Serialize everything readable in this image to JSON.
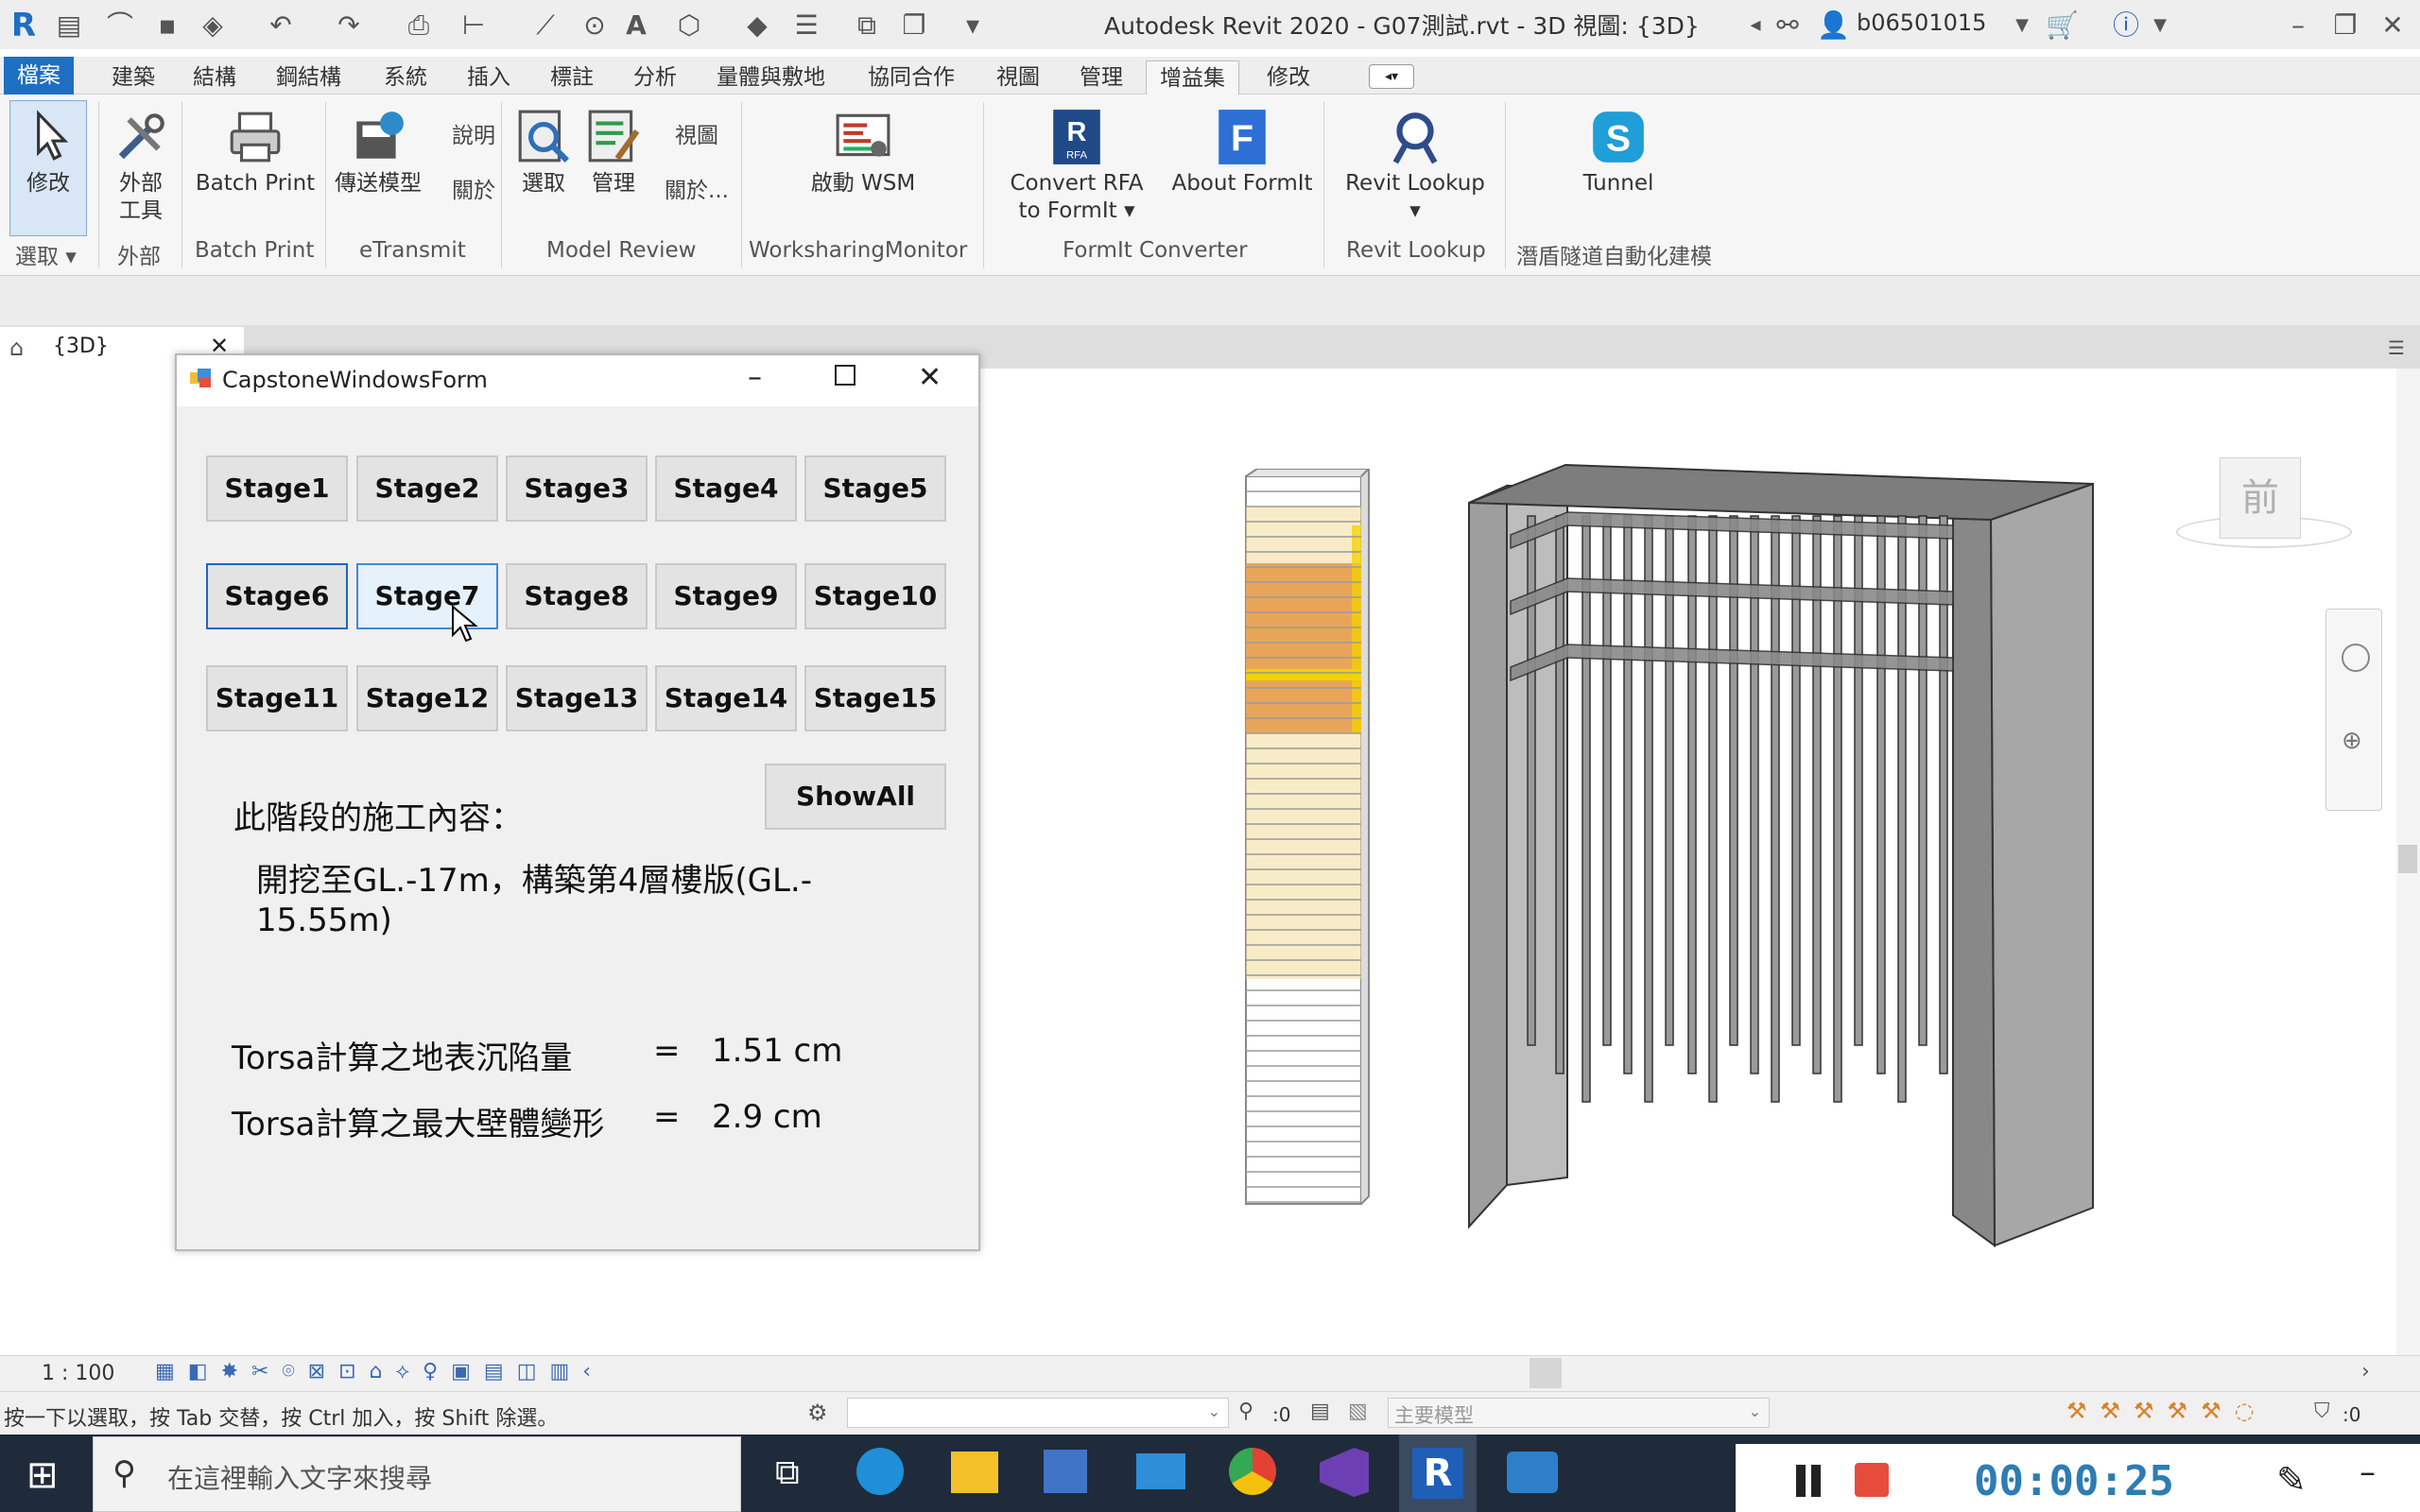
{
  "window": {
    "title": "Autodesk Revit 2020 - G07測試.rvt - 3D 視圖: {3D}",
    "username": "b06501015"
  },
  "menu": {
    "tabs": [
      "檔案",
      "建築",
      "結構",
      "鋼結構",
      "系統",
      "插入",
      "標註",
      "分析",
      "量體與敷地",
      "協同合作",
      "視圖",
      "管理",
      "增益集",
      "修改"
    ],
    "active": "增益集"
  },
  "ribbon": {
    "modify": "修改",
    "external_tools": [
      "外部",
      "工具"
    ],
    "batch_print": "Batch Print",
    "etransmit": "傳送模型",
    "help_label": "說明",
    "about_label": "關於",
    "select_label": "選取",
    "manage_label": "管理",
    "view_label": "視圖",
    "about_dots_label": "關於...",
    "wsm": "啟動 WSM",
    "convert_rfa": [
      "Convert RFA",
      "to FormIt"
    ],
    "about_formit": "About FormIt",
    "revit_lookup": "Revit Lookup",
    "tunnel": "Tunnel",
    "groups": {
      "select": "選取",
      "external": "外部",
      "batch_print": "Batch Print",
      "etransmit": "eTransmit",
      "model_review": "Model Review",
      "worksharing": "WorksharingMonitor",
      "formit": "FormIt Converter",
      "revit_lookup": "Revit Lookup",
      "tunnel_auto": "潛盾隧道自動化建模"
    }
  },
  "view_tab": {
    "label": "{3D}"
  },
  "viewcube": {
    "face": "前"
  },
  "form": {
    "title": "CapstoneWindowsForm",
    "stages": [
      "Stage1",
      "Stage2",
      "Stage3",
      "Stage4",
      "Stage5",
      "Stage6",
      "Stage7",
      "Stage8",
      "Stage9",
      "Stage10",
      "Stage11",
      "Stage12",
      "Stage13",
      "Stage14",
      "Stage15"
    ],
    "selected_stage": "Stage6",
    "show_all": "ShowAll",
    "content_heading": "此階段的施工內容：",
    "content_line1": "開挖至GL.-17m，構築第4層樓版(GL.-",
    "content_line2": "15.55m)",
    "settlement_label": "Torsa計算之地表沉陷量",
    "settlement_eq": "=",
    "settlement_value": "1.51 cm",
    "deformation_label": "Torsa計算之最大壁體變形",
    "deformation_eq": "=",
    "deformation_value": "2.9 cm"
  },
  "scale": "1 : 100",
  "status": {
    "hint": "按一下以選取，按 Tab 交替，按 Ctrl 加入，按 Shift 除選。",
    "count1": ":0",
    "model": "主要模型",
    "filter_count": ":0"
  },
  "taskbar": {
    "search_placeholder": "在這裡輸入文字來搜尋"
  },
  "recorder": {
    "time": "00:00:25"
  },
  "colors": {
    "file_tab": "#1e6fc2",
    "selected_border": "#1a66c9",
    "hover_bg": "#e5f1fb",
    "soil_orange": "#e8a559",
    "soil_yellow": "#f2dc9b",
    "stop_red": "#e74c3c",
    "timer_blue": "#2d7db3"
  }
}
